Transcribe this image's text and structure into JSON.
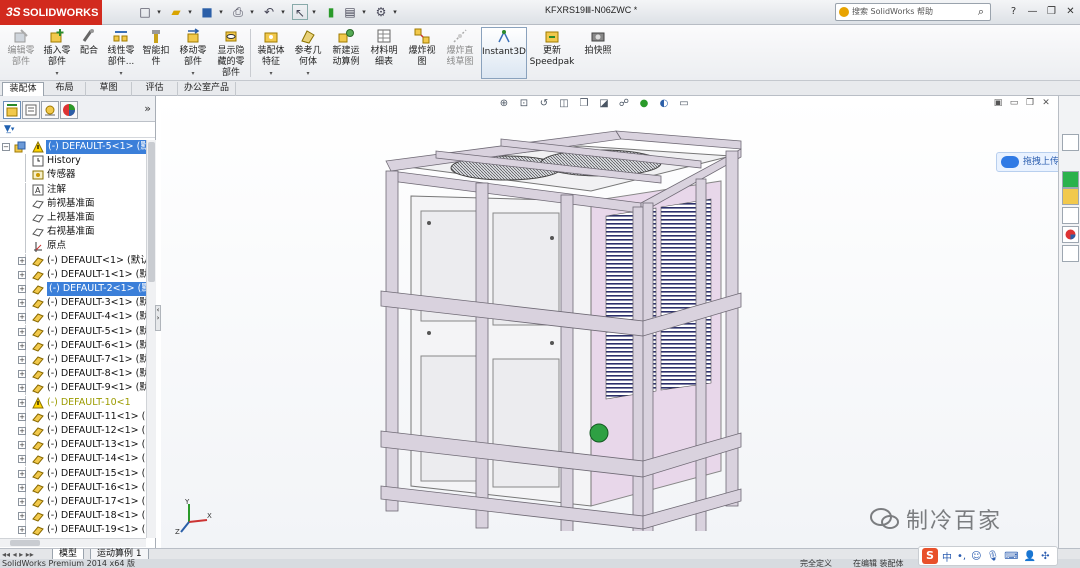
{
  "app": {
    "brand": "SOLIDWORKS",
    "brand_prefix": "3S",
    "document_title": "KFXRS19Ⅲ-N06ZWC *",
    "search_placeholder": "搜索 SolidWorks 帮助"
  },
  "toolbar": {
    "buttons": [
      {
        "label": "编辑零部件",
        "lines": [
          "编辑零",
          "部件"
        ],
        "enabled": false
      },
      {
        "label": "插入零部件",
        "lines": [
          "插入零",
          "部件"
        ],
        "enabled": true
      },
      {
        "label": "配合",
        "lines": [
          "配合"
        ],
        "enabled": true
      },
      {
        "label": "线性零部件...",
        "lines": [
          "线性零",
          "部件..."
        ],
        "enabled": true
      },
      {
        "label": "智能扣件",
        "lines": [
          "智能扣",
          "件"
        ],
        "enabled": true
      },
      {
        "label": "移动零部件",
        "lines": [
          "移动零",
          "部件"
        ],
        "enabled": true
      },
      {
        "label": "显示隐藏的零部件",
        "lines": [
          "显示隐",
          "藏的零",
          "部件"
        ],
        "enabled": true
      },
      {
        "label": "装配体特征",
        "lines": [
          "装配体",
          "特征"
        ],
        "enabled": true
      },
      {
        "label": "参考几何体",
        "lines": [
          "参考几",
          "何体"
        ],
        "enabled": true
      },
      {
        "label": "新建运动算例",
        "lines": [
          "新建运",
          "动算例"
        ],
        "enabled": true
      },
      {
        "label": "材料明细表",
        "lines": [
          "材料明",
          "细表"
        ],
        "enabled": true
      },
      {
        "label": "爆炸视图",
        "lines": [
          "爆炸视",
          "图"
        ],
        "enabled": true
      },
      {
        "label": "爆炸直线草图",
        "lines": [
          "爆炸直",
          "线草图"
        ],
        "enabled": false
      },
      {
        "label": "Instant3D",
        "lines": [
          "Instant3D"
        ],
        "enabled": true
      },
      {
        "label": "更新 Speedpak",
        "lines": [
          "更新",
          "Speedpak"
        ],
        "enabled": true
      },
      {
        "label": "拍快照",
        "lines": [
          "拍快照"
        ],
        "enabled": true
      }
    ]
  },
  "tabs": [
    "装配体",
    "布局",
    "草图",
    "评估",
    "办公室产品"
  ],
  "active_tab": "装配体",
  "feature_tree": {
    "root": "(-) DEFAULT-5<1> (默",
    "items": [
      {
        "label": "History",
        "type": "history"
      },
      {
        "label": "传感器",
        "type": "sensor"
      },
      {
        "label": "注解",
        "type": "annotation"
      },
      {
        "label": "前视基准面",
        "type": "plane"
      },
      {
        "label": "上视基准面",
        "type": "plane"
      },
      {
        "label": "右视基准面",
        "type": "plane"
      },
      {
        "label": "原点",
        "type": "origin"
      },
      {
        "label": "(-) DEFAULT<1> (默认",
        "type": "part"
      },
      {
        "label": "(-) DEFAULT-1<1> (默",
        "type": "part"
      },
      {
        "label": "(-) DEFAULT-2<1> (默",
        "type": "part",
        "selected": true
      },
      {
        "label": "(-) DEFAULT-3<1> (默",
        "type": "part"
      },
      {
        "label": "(-) DEFAULT-4<1> (默",
        "type": "part"
      },
      {
        "label": "(-) DEFAULT-5<1> (默",
        "type": "part"
      },
      {
        "label": "(-) DEFAULT-6<1> (默",
        "type": "part"
      },
      {
        "label": "(-) DEFAULT-7<1> (默",
        "type": "part"
      },
      {
        "label": "(-) DEFAULT-8<1> (默",
        "type": "part"
      },
      {
        "label": "(-) DEFAULT-9<1> (默",
        "type": "part"
      },
      {
        "label": "(-) DEFAULT-10<1",
        "type": "warn"
      },
      {
        "label": "(-) DEFAULT-11<1> (",
        "type": "part"
      },
      {
        "label": "(-) DEFAULT-12<1> (",
        "type": "part"
      },
      {
        "label": "(-) DEFAULT-13<1> (",
        "type": "part"
      },
      {
        "label": "(-) DEFAULT-14<1> (",
        "type": "part"
      },
      {
        "label": "(-) DEFAULT-15<1> (",
        "type": "part"
      },
      {
        "label": "(-) DEFAULT-16<1> (",
        "type": "part"
      },
      {
        "label": "(-) DEFAULT-17<1> (",
        "type": "part"
      },
      {
        "label": "(-) DEFAULT-18<1> (",
        "type": "part"
      },
      {
        "label": "(-) DEFAULT-19<1> (",
        "type": "part"
      }
    ]
  },
  "bottom_tabs": [
    "模型",
    "运动算例 1"
  ],
  "status_bar": {
    "left": "SolidWorks Premium 2014 x64 版",
    "middle": "完全定义",
    "right": "在编辑 装配体"
  },
  "baidu": {
    "label": "拖拽上传"
  },
  "ime": {
    "label": "中"
  },
  "watermark": "制冷百家",
  "colors": {
    "selection": "#3b7fd9",
    "brand_red": "#d22a1e",
    "unit_frame": "#d9d2de",
    "warning": "#9b9b00"
  }
}
